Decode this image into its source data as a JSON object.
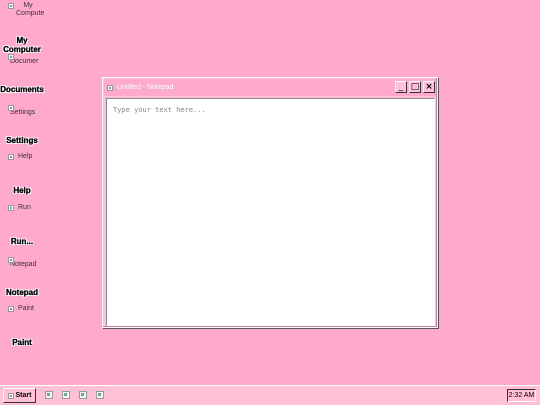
{
  "desktop": {
    "icons": [
      {
        "alt": "My Compute",
        "title": "My Computer"
      },
      {
        "alt": "Documer",
        "title": "Documents"
      },
      {
        "alt": "Settings",
        "title": "Settings"
      },
      {
        "alt": "Help",
        "title": "Help"
      },
      {
        "alt": "Run",
        "title": "Run..."
      },
      {
        "alt": "Notepad",
        "title": "Notepad"
      },
      {
        "alt": "Paint",
        "title": "Paint"
      }
    ]
  },
  "notepad": {
    "title": "Untitled - Notepad",
    "icon": "notepad-icon",
    "minimize_label": "_",
    "maximize_label": "□",
    "close_label": "×",
    "placeholder": "Type your text here...",
    "value": ""
  },
  "taskbar": {
    "start_label": "Start",
    "clock": "2:32 AM"
  },
  "colors": {
    "desktop_bg": "#ffaacc",
    "window_bg": "#ffc0d8"
  }
}
